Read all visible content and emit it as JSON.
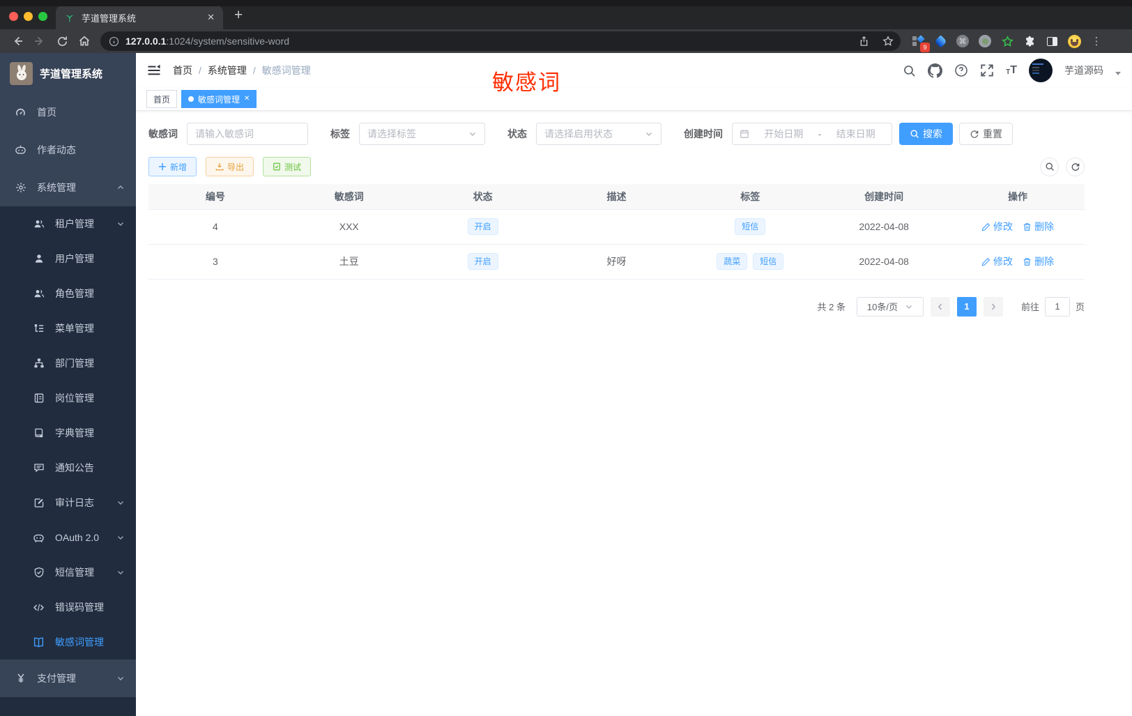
{
  "colors": {
    "accent": "#409eff",
    "annotation_red": "#ff2d00",
    "sidebar_bg": "#374357",
    "submenu_bg": "#212c3e"
  },
  "browser": {
    "tab_title": "芋道管理系统",
    "close_tab_glyph": "✕",
    "new_tab_glyph": "+",
    "url_host": "127.0.0.1",
    "url_rest": ":1024/system/sensitive-word",
    "extension_badge": "9"
  },
  "sidebar": {
    "logo_title": "芋道管理系统",
    "items": [
      {
        "label": "首页",
        "icon": "dashboard-icon",
        "level": 1
      },
      {
        "label": "作者动态",
        "icon": "author-activity-icon",
        "level": 1
      },
      {
        "label": "系统管理",
        "icon": "gear-icon",
        "level": 1,
        "chevron": "up"
      },
      {
        "label": "租户管理",
        "icon": "tenant-users-icon",
        "level": 2,
        "chevron": "down"
      },
      {
        "label": "用户管理",
        "icon": "user-icon",
        "level": 2
      },
      {
        "label": "角色管理",
        "icon": "role-users-icon",
        "level": 2
      },
      {
        "label": "菜单管理",
        "icon": "menu-tree-icon",
        "level": 2
      },
      {
        "label": "部门管理",
        "icon": "org-tree-icon",
        "level": 2
      },
      {
        "label": "岗位管理",
        "icon": "post-badge-icon",
        "level": 2
      },
      {
        "label": "字典管理",
        "icon": "dictionary-book-icon",
        "level": 2
      },
      {
        "label": "通知公告",
        "icon": "announcement-icon",
        "level": 2
      },
      {
        "label": "审计日志",
        "icon": "audit-log-icon",
        "level": 2,
        "chevron": "down"
      },
      {
        "label": "OAuth 2.0",
        "icon": "oauth-robot-icon",
        "level": 2,
        "chevron": "down"
      },
      {
        "label": "短信管理",
        "icon": "sms-shield-icon",
        "level": 2,
        "chevron": "down"
      },
      {
        "label": "错误码管理",
        "icon": "error-code-icon",
        "level": 2
      },
      {
        "label": "敏感词管理",
        "icon": "sensitive-word-book-icon",
        "level": 2,
        "active": true
      },
      {
        "label": "支付管理",
        "icon": "payment-yen-icon",
        "level": 1,
        "chevron": "down"
      }
    ]
  },
  "navbar": {
    "breadcrumb": [
      "首页",
      "系统管理",
      "敏感词管理"
    ],
    "annotation": "敏感词",
    "username": "芋道源码"
  },
  "tags": [
    {
      "label": "首页",
      "active": false
    },
    {
      "label": "敏感词管理",
      "active": true,
      "close_glyph": "✕"
    }
  ],
  "filters": {
    "keyword_label": "敏感词",
    "keyword_placeholder": "请输入敏感词",
    "tag_label": "标签",
    "tag_placeholder": "请选择标签",
    "status_label": "状态",
    "status_placeholder": "请选择启用状态",
    "date_label": "创建时间",
    "date_start_placeholder": "开始日期",
    "date_separator": "-",
    "date_end_placeholder": "结束日期",
    "search_label": "搜索",
    "reset_label": "重置"
  },
  "toolbar": {
    "add_label": "新增",
    "export_label": "导出",
    "test_label": "测试"
  },
  "table": {
    "columns": [
      "编号",
      "敏感词",
      "状态",
      "描述",
      "标签",
      "创建时间",
      "操作"
    ],
    "rows": [
      {
        "id": "4",
        "word": "XXX",
        "status": "开启",
        "description": "",
        "tags": [
          "短信"
        ],
        "created": "2022-04-08",
        "edit_label": "修改",
        "delete_label": "删除"
      },
      {
        "id": "3",
        "word": "土豆",
        "status": "开启",
        "description": "好呀",
        "tags": [
          "蔬菜",
          "短信"
        ],
        "created": "2022-04-08",
        "edit_label": "修改",
        "delete_label": "删除"
      }
    ]
  },
  "pagination": {
    "total_label": "共 2 条",
    "page_size_label": "10条/页",
    "current_page": "1",
    "goto_label": "前往",
    "goto_value": "1",
    "unit_label": "页"
  }
}
